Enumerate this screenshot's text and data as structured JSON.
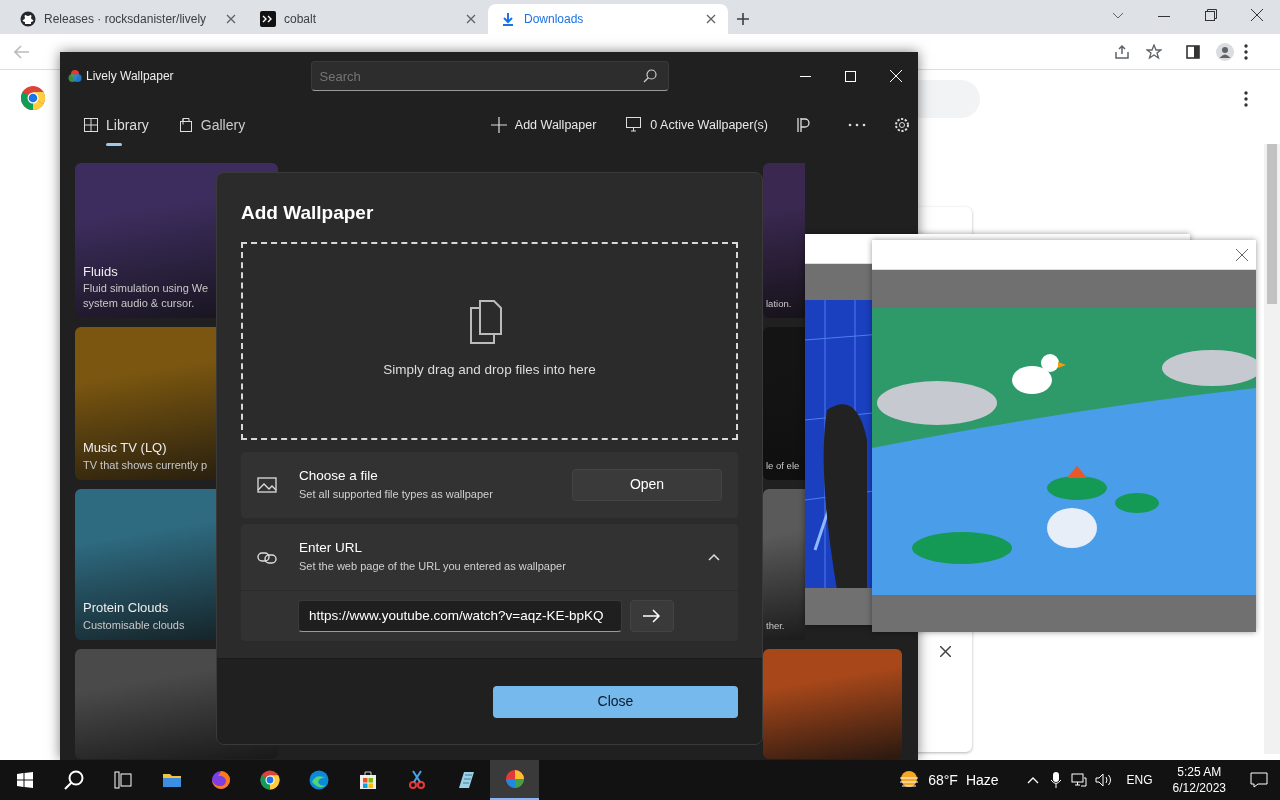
{
  "browser": {
    "tabs": [
      {
        "kind": "site",
        "title": "Releases · rocksdanister/lively",
        "selected": false
      },
      {
        "kind": "terminal",
        "title": "cobalt",
        "selected": false
      },
      {
        "kind": "download",
        "title": "Downloads",
        "selected": true
      }
    ]
  },
  "window": {
    "title": "Lively Wallpaper"
  },
  "search": {
    "placeholder": "Search"
  },
  "nav": [
    {
      "kind": "grid",
      "label": "Library",
      "selected": true
    },
    {
      "kind": "bag",
      "label": "Gallery",
      "selected": false
    }
  ],
  "toolbar": [
    {
      "kind": "plus",
      "label": "Add Wallpaper"
    },
    {
      "kind": "monitor",
      "label": "0 Active Wallpaper(s)"
    }
  ],
  "library": {
    "left": [
      {
        "color": "#3d2d5e",
        "title": "Fluids",
        "lines": [
          "Fluid simulation using We",
          "system audio & cursor."
        ]
      },
      {
        "color": "#7a5610",
        "title": "Music TV (LQ)",
        "lines": [
          "TV that shows currently p"
        ]
      },
      {
        "color": "#2e6a80",
        "title": "Protein Clouds",
        "lines": [
          "Customisable clouds"
        ]
      },
      {
        "color": "#4a4a4a"
      }
    ],
    "right": [
      {
        "color": "#3a2850",
        "lines": [
          "lation."
        ]
      },
      {
        "color": "#141414",
        "lines": [
          "le of ele"
        ]
      },
      {
        "color": "#5a5a5a",
        "lines": [
          "ther."
        ]
      },
      {
        "color": "#a8481a"
      }
    ]
  },
  "dialog": {
    "title": "Add Wallpaper",
    "drop_hint": "Simply drag and drop files into here",
    "options": [
      {
        "kind": "file",
        "title": "Choose a file",
        "subtitle": "Set all supported file types as wallpaper",
        "button": "Open"
      },
      {
        "kind": "url",
        "title": "Enter URL",
        "subtitle": "Set the web page of the URL you entered as wallpaper",
        "expanded": true,
        "url": "https://www.youtube.com/watch?v=aqz-KE-bpKQ"
      }
    ],
    "close": "Close"
  },
  "taskbar": {
    "apps": [
      {
        "kind": "taskview",
        "active": false
      },
      {
        "kind": "folder",
        "active": false
      },
      {
        "kind": "fox",
        "active": false
      },
      {
        "kind": "chrome",
        "active": false
      },
      {
        "kind": "wave",
        "active": false
      },
      {
        "kind": "store",
        "active": false
      },
      {
        "kind": "scissors",
        "active": false
      },
      {
        "kind": "notepad",
        "active": false
      },
      {
        "kind": "lively",
        "active": true
      }
    ],
    "weather": {
      "temp": "68°F",
      "condition": "Haze"
    },
    "language": "ENG",
    "time": "5:25 AM",
    "date": "6/12/2023"
  }
}
